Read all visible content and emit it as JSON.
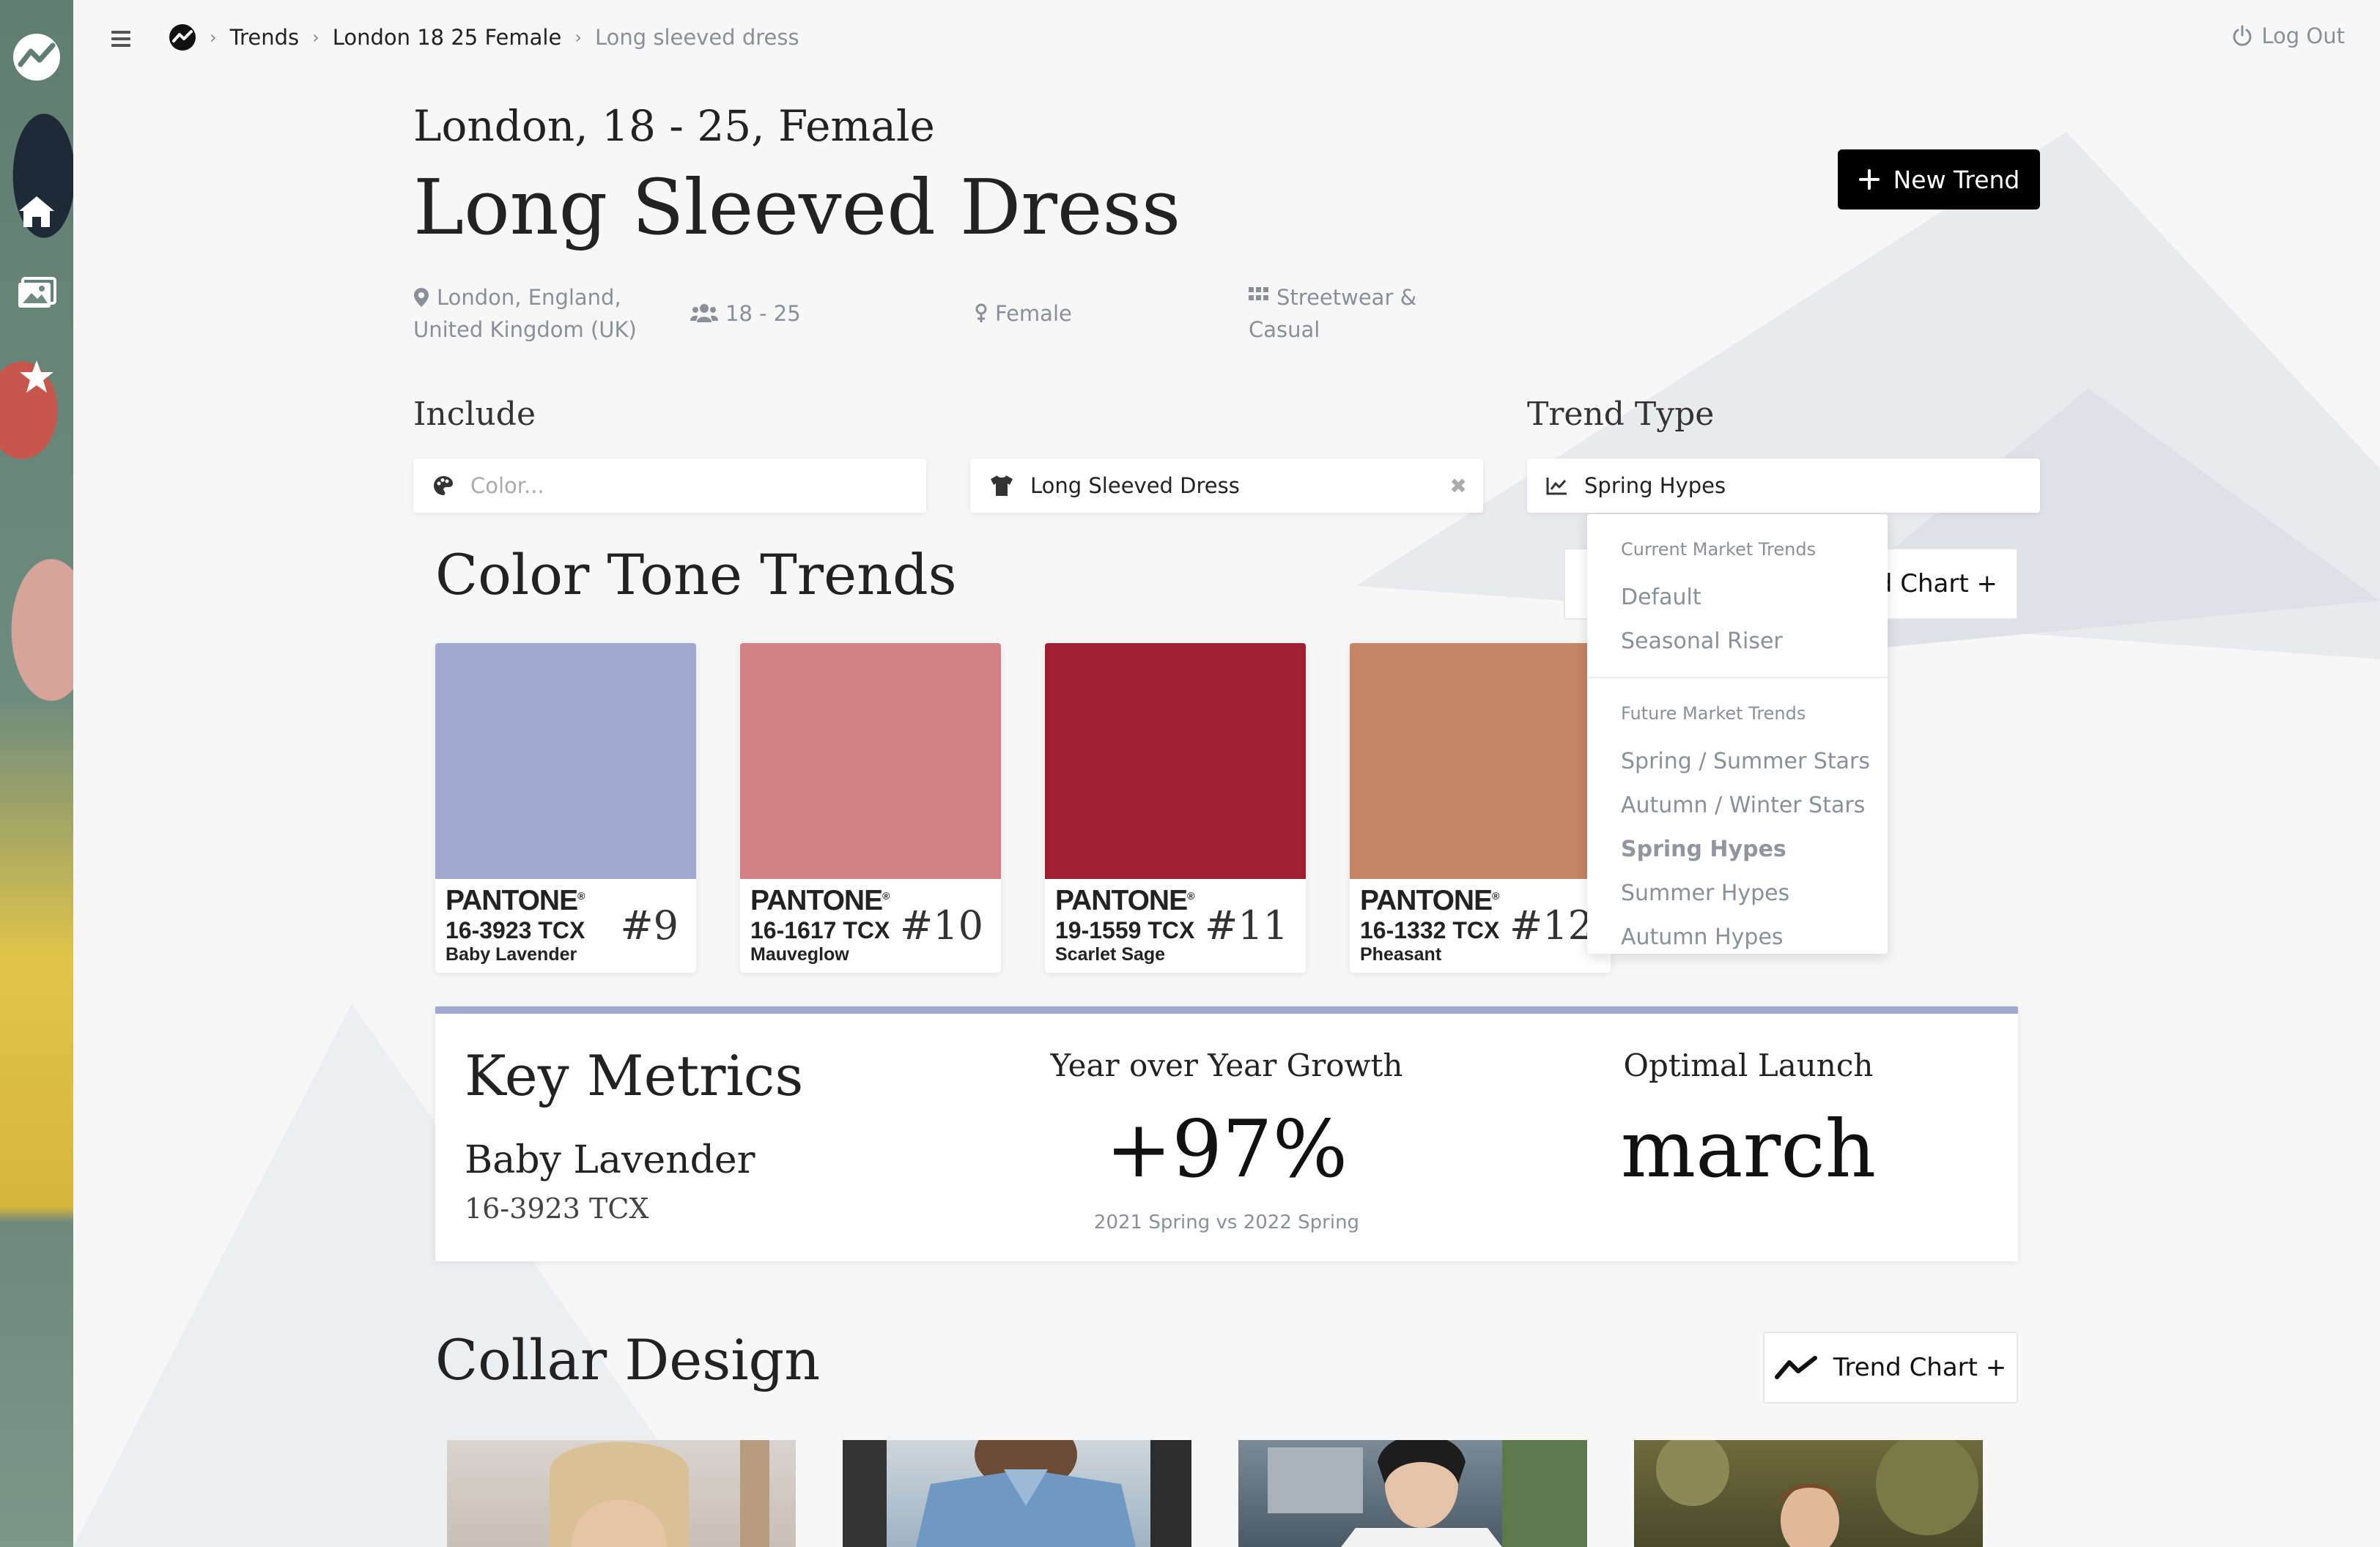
{
  "breadcrumb": {
    "items": [
      "Trends",
      "London 18 25 Female",
      "Long sleeved dress"
    ]
  },
  "header": {
    "logout_label": "Log Out",
    "subtitle": "London, 18 - 25, Female",
    "title": "Long Sleeved Dress",
    "new_trend_label": "New Trend"
  },
  "meta": {
    "location_line1": "London, England,",
    "location_line2": "United Kingdom (UK)",
    "age": "18 - 25",
    "gender": "Female",
    "style_line1": "Streetwear &",
    "style_line2": "Casual"
  },
  "filters": {
    "include_label": "Include",
    "color_placeholder": "Color...",
    "garment_value": "Long Sleeved Dress",
    "trend_type_label": "Trend Type",
    "trend_type_value": "Spring Hypes"
  },
  "dropdown": {
    "group_current": "Current Market Trends",
    "current_items": [
      "Default",
      "Seasonal Riser"
    ],
    "group_future": "Future Market Trends",
    "future_items": [
      "Spring / Summer Stars",
      "Autumn / Winter Stars",
      "Spring Hypes",
      "Summer Hypes",
      "Autumn Hypes"
    ],
    "selected": "Spring Hypes"
  },
  "color_tone": {
    "title": "Color Tone Trends",
    "chart_button_label": "d Chart +",
    "swatches": [
      {
        "hex": "#a1a8d0",
        "brand": "PANTONE",
        "code": "16-3923 TCX",
        "name": "Baby Lavender",
        "rank": "#9"
      },
      {
        "hex": "#d38185",
        "brand": "PANTONE",
        "code": "16-1617 TCX",
        "name": "Mauveglow",
        "rank": "#10"
      },
      {
        "hex": "#a01f30",
        "brand": "PANTONE",
        "code": "19-1559 TCX",
        "name": "Scarlet Sage",
        "rank": "#11"
      },
      {
        "hex": "#c58463",
        "brand": "PANTONE",
        "code": "16-1332 TCX",
        "name": "Pheasant",
        "rank": "#12"
      }
    ]
  },
  "key_metrics": {
    "title": "Key Metrics",
    "color_name": "Baby Lavender",
    "color_code": "16-3923 TCX",
    "yoy_label": "Year over Year Growth",
    "yoy_value": "+97%",
    "yoy_note": "2021 Spring vs 2022 Spring",
    "launch_label": "Optimal Launch",
    "launch_value": "march"
  },
  "collar": {
    "title": "Collar Design",
    "chart_button_label": "Trend Chart +"
  },
  "colors": {
    "primary": "#000000",
    "accent": "#a1a8d0",
    "muted_text": "#8a8f99"
  }
}
